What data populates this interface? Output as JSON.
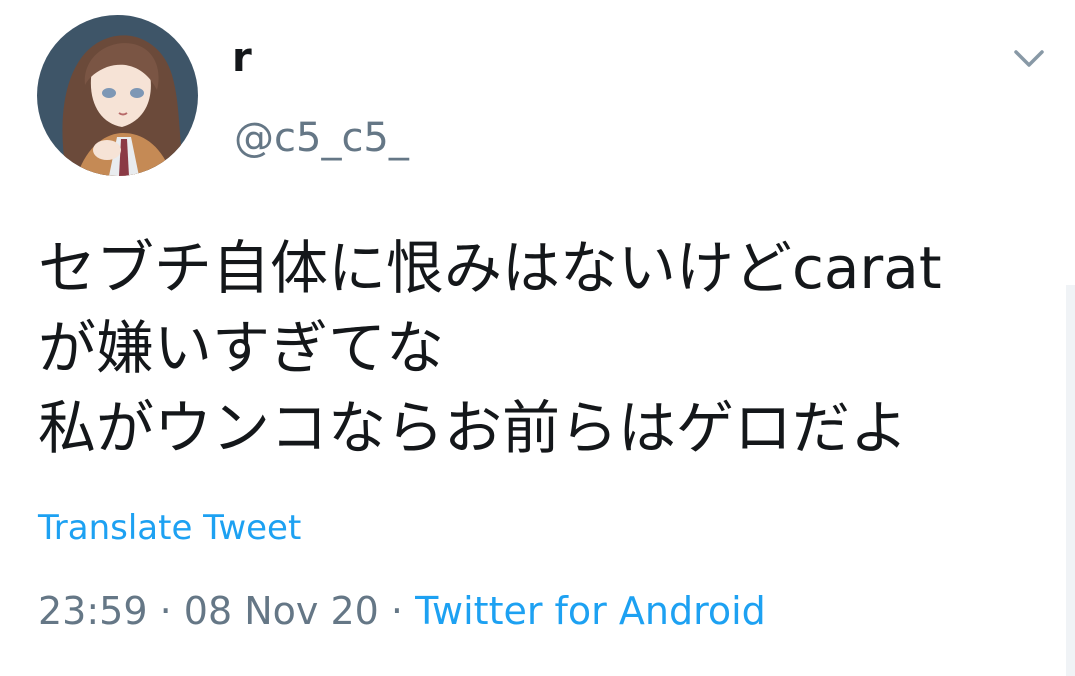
{
  "user": {
    "display_name": "r",
    "handle": "@c5_c5_",
    "avatar_icon": "avatar-illustration"
  },
  "menu": {
    "icon": "chevron-down-icon"
  },
  "tweet": {
    "lines": [
      "セブチ自体に恨みはないけどcarat",
      "が嫌いすぎてな",
      "私がウンコならお前らはゲロだよ"
    ],
    "translate_label": "Translate Tweet",
    "time": "23:59",
    "separator": "·",
    "date": "08 Nov 20",
    "source": "Twitter for Android"
  },
  "colors": {
    "link": "#1da1f2",
    "secondary_text": "#657786",
    "primary_text": "#14171a"
  }
}
